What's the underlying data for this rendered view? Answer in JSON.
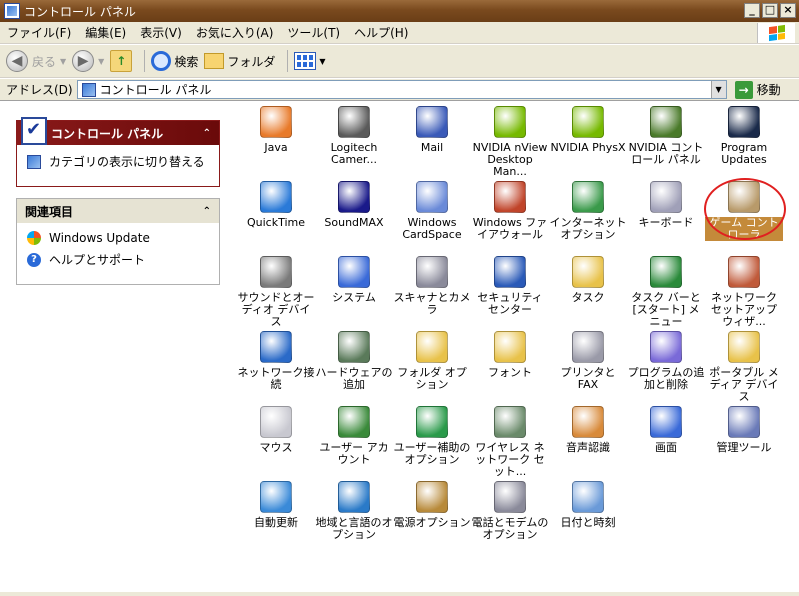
{
  "window": {
    "title": "コントロール パネル"
  },
  "title_buttons": {
    "minimize": "_",
    "maximize": "□",
    "close": "×"
  },
  "menu": [
    "ファイル(F)",
    "編集(E)",
    "表示(V)",
    "お気に入り(A)",
    "ツール(T)",
    "ヘルプ(H)"
  ],
  "toolbar": {
    "back_label": "戻る",
    "search_label": "検索",
    "folders_label": "フォルダ"
  },
  "address": {
    "label": "アドレス(D)",
    "value": "コントロール パネル",
    "go_label": "移動"
  },
  "left_panel": {
    "control_panel_box": {
      "title": "コントロール パネル",
      "link": "カテゴリの表示に切り替える"
    },
    "related_box": {
      "title": "関連項目",
      "links": [
        "Windows Update",
        "ヘルプとサポート"
      ]
    }
  },
  "items": [
    {
      "label": "Java",
      "icon": "java-icon",
      "color": "#e87a2a"
    },
    {
      "label": "Logitech Camer...",
      "icon": "logitech-camera-icon",
      "color": "#5a5a5a"
    },
    {
      "label": "Mail",
      "icon": "mail-icon",
      "color": "#3a5ab8"
    },
    {
      "label": "NVIDIA nView Desktop Man...",
      "icon": "nvidia-icon",
      "color": "#76b900"
    },
    {
      "label": "NVIDIA PhysX",
      "icon": "nvidia-icon",
      "color": "#76b900"
    },
    {
      "label": "NVIDIA コントロール パネル",
      "icon": "nvidia-control-icon",
      "color": "#4a7a2a"
    },
    {
      "label": "Program Updates",
      "icon": "program-updates-icon",
      "color": "#1a2a4a"
    },
    {
      "label": "QuickTime",
      "icon": "quicktime-icon",
      "color": "#2a7ad8"
    },
    {
      "label": "SoundMAX",
      "icon": "soundmax-icon",
      "color": "#1a1a8a"
    },
    {
      "label": "Windows CardSpace",
      "icon": "cardspace-icon",
      "color": "#6a8ad8"
    },
    {
      "label": "Windows ファイアウォール",
      "icon": "firewall-icon",
      "color": "#c0442a"
    },
    {
      "label": "インターネット オプション",
      "icon": "internet-options-icon",
      "color": "#3a9a4a"
    },
    {
      "label": "キーボード",
      "icon": "keyboard-icon",
      "color": "#a0a0b8"
    },
    {
      "label": "ゲーム コントローラ",
      "icon": "game-controller-icon",
      "color": "#b89a6a"
    },
    {
      "label": "サウンドとオーディオ デバイス",
      "icon": "sound-icon",
      "color": "#7a7a7a"
    },
    {
      "label": "システム",
      "icon": "system-icon",
      "color": "#3a6ad8"
    },
    {
      "label": "スキャナとカメラ",
      "icon": "scanner-camera-icon",
      "color": "#8a8a9a"
    },
    {
      "label": "セキュリティ センター",
      "icon": "security-center-icon",
      "color": "#2a5ab8"
    },
    {
      "label": "タスク",
      "icon": "tasks-icon",
      "color": "#e8c24a"
    },
    {
      "label": "タスク バーと [スタート] メニュー",
      "icon": "taskbar-icon",
      "color": "#2a8a3a"
    },
    {
      "label": "ネットワーク セットアップ ウィザ...",
      "icon": "network-setup-icon",
      "color": "#c05a3a"
    },
    {
      "label": "ネットワーク接続",
      "icon": "network-connections-icon",
      "color": "#2a6ac8"
    },
    {
      "label": "ハードウェアの追加",
      "icon": "add-hardware-icon",
      "color": "#5a7a5a"
    },
    {
      "label": "フォルダ オプション",
      "icon": "folder-options-icon",
      "color": "#e8c24a"
    },
    {
      "label": "フォント",
      "icon": "fonts-icon",
      "color": "#e8c24a"
    },
    {
      "label": "プリンタと FAX",
      "icon": "printers-icon",
      "color": "#9a9aa8"
    },
    {
      "label": "プログラムの追加と削除",
      "icon": "add-remove-programs-icon",
      "color": "#7a6ad8"
    },
    {
      "label": "ポータブル メディア デバイス",
      "icon": "portable-media-icon",
      "color": "#e8c24a"
    },
    {
      "label": "マウス",
      "icon": "mouse-icon",
      "color": "#c8c8d0"
    },
    {
      "label": "ユーザー アカウント",
      "icon": "user-accounts-icon",
      "color": "#3a8a3a"
    },
    {
      "label": "ユーザー補助のオプション",
      "icon": "accessibility-icon",
      "color": "#2a9a4a"
    },
    {
      "label": "ワイヤレス ネットワーク セット...",
      "icon": "wireless-icon",
      "color": "#6a8a6a"
    },
    {
      "label": "音声認識",
      "icon": "speech-icon",
      "color": "#d88a3a"
    },
    {
      "label": "画面",
      "icon": "display-icon",
      "color": "#3a6ad8"
    },
    {
      "label": "管理ツール",
      "icon": "admin-tools-icon",
      "color": "#6a7ab8"
    },
    {
      "label": "自動更新",
      "icon": "automatic-updates-icon",
      "color": "#3a8ad8"
    },
    {
      "label": "地域と言語のオプション",
      "icon": "regional-icon",
      "color": "#2a7ac8"
    },
    {
      "label": "電源オプション",
      "icon": "power-options-icon",
      "color": "#b88a3a"
    },
    {
      "label": "電話とモデムのオプション",
      "icon": "phone-modem-icon",
      "color": "#8a8a9a"
    },
    {
      "label": "日付と時刻",
      "icon": "date-time-icon",
      "color": "#6a9ad8"
    }
  ]
}
